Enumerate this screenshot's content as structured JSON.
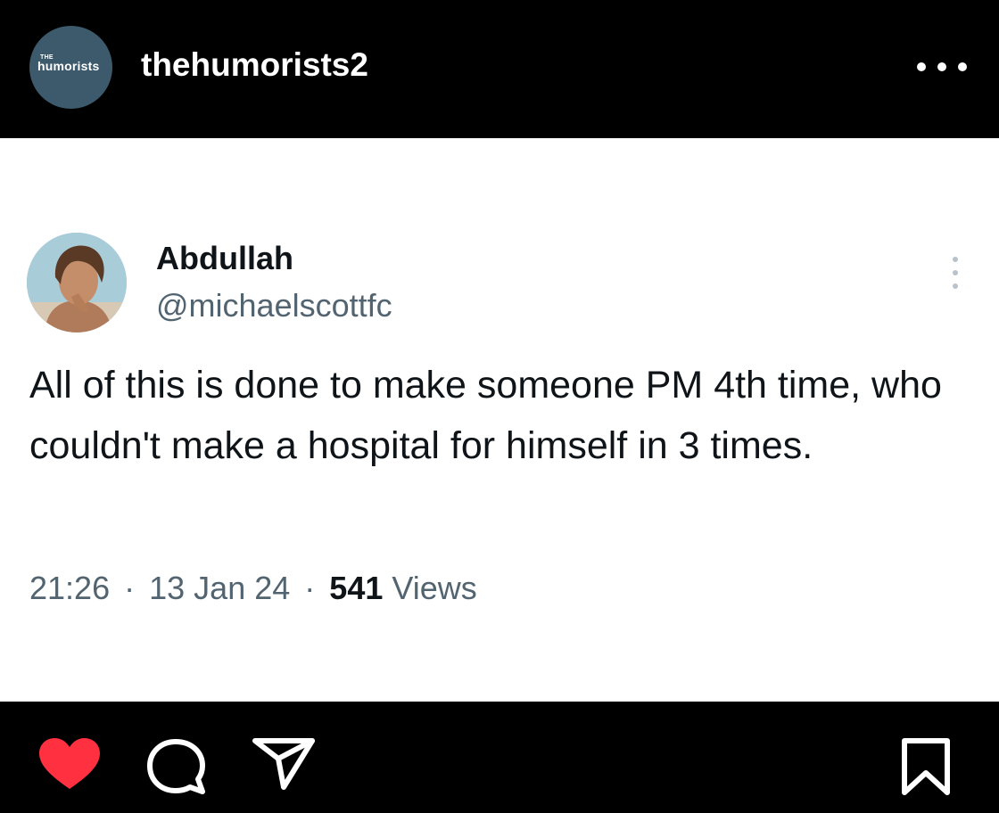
{
  "header": {
    "account_name": "thehumorists2",
    "logo_top": "THE",
    "logo_word": "humorists",
    "avatar_color": "#3d5a6c",
    "more_icon": "more-horizontal-icon"
  },
  "tweet": {
    "display_name": "Abdullah",
    "handle": "@michaelscottfc",
    "text": "All of this is done to make someone PM 4th time, who couldn't make a hospital for himself in 3 times.",
    "time": "21:26",
    "separator": "·",
    "date": "13 Jan 24",
    "views_count": "541",
    "views_label": "Views",
    "more_icon": "more-vertical-icon"
  },
  "actions": {
    "like_icon": "heart-icon",
    "like_color": "#ff3040",
    "comment_icon": "comment-icon",
    "share_icon": "share-icon",
    "save_icon": "bookmark-icon"
  },
  "colors": {
    "background": "#000000",
    "card": "#ffffff",
    "text_primary": "#0f1419",
    "text_secondary": "#536471"
  }
}
